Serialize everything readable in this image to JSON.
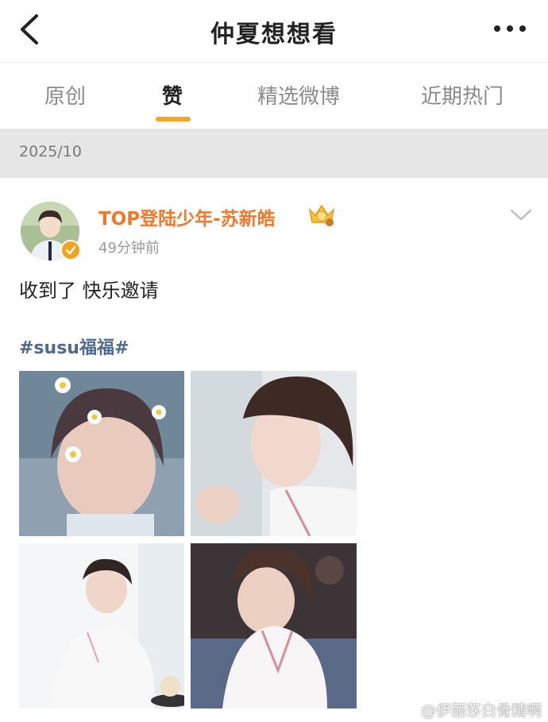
{
  "header": {
    "title": "仲夏想想看",
    "back_icon": "chevron-left-icon",
    "more_icon": "more-dots-icon"
  },
  "tabs": [
    {
      "label": "原创",
      "active": false
    },
    {
      "label": "赞",
      "active": true
    },
    {
      "label": "精选微博",
      "active": false
    },
    {
      "label": "近期热门",
      "active": false
    }
  ],
  "date_header": "2025/10",
  "post": {
    "author": "TOP登陆少年-苏新皓",
    "badge_icon": "crown-icon",
    "time": "49分钟前",
    "text": "收到了 快乐邀请",
    "hashtag": "#susu福福#",
    "menu_icon": "chevron-down-icon",
    "photos": [
      "photo-1",
      "photo-2",
      "photo-3",
      "photo-4"
    ]
  },
  "watermark": "@伊丽莎白骨精啊",
  "colors": {
    "accent": "#f5a623",
    "author": "#f0782a",
    "hashtag": "#4e6a8e",
    "date_bar": "#e6e6e6"
  }
}
